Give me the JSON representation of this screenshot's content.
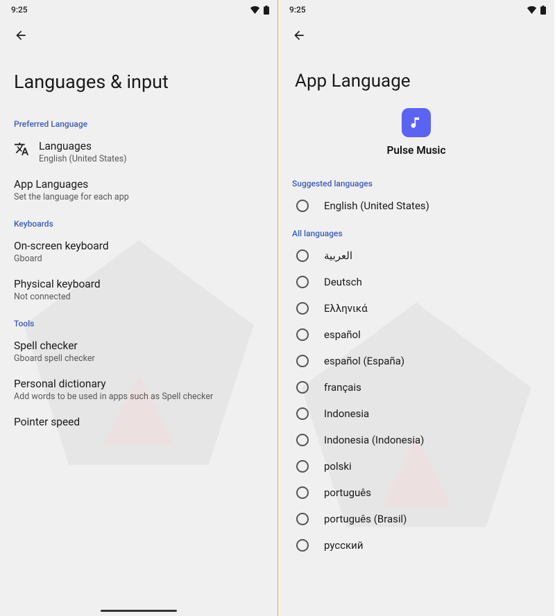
{
  "status": {
    "time": "9:25"
  },
  "left": {
    "title": "Languages & input",
    "sections": {
      "preferred": {
        "header": "Preferred Language",
        "languages": {
          "title": "Languages",
          "sub": "English (United States)"
        },
        "appLanguages": {
          "title": "App Languages",
          "sub": "Set the language for each app"
        }
      },
      "keyboards": {
        "header": "Keyboards",
        "onscreen": {
          "title": "On-screen keyboard",
          "sub": "Gboard"
        },
        "physical": {
          "title": "Physical keyboard",
          "sub": "Not connected"
        }
      },
      "tools": {
        "header": "Tools",
        "spell": {
          "title": "Spell checker",
          "sub": "Gboard spell checker"
        },
        "dict": {
          "title": "Personal dictionary",
          "sub": "Add words to be used in apps such as Spell checker"
        },
        "pointer": {
          "title": "Pointer speed"
        }
      }
    }
  },
  "right": {
    "title": "App Language",
    "app": {
      "name": "Pulse Music"
    },
    "suggested": {
      "header": "Suggested languages",
      "items": [
        "English (United States)"
      ]
    },
    "all": {
      "header": "All languages",
      "items": [
        "العربية",
        "Deutsch",
        "Ελληνικά",
        "español",
        "español (España)",
        "français",
        "Indonesia",
        "Indonesia (Indonesia)",
        "polski",
        "português",
        "português (Brasil)",
        "русский"
      ]
    }
  }
}
